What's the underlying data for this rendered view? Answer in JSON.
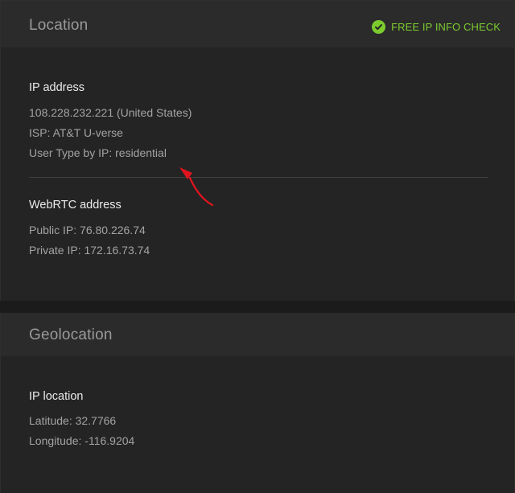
{
  "location": {
    "title": "Location",
    "free_check_label": "FREE IP INFO CHECK",
    "check_icon": "check-circle-icon",
    "ip_section": {
      "heading": "IP address",
      "ip_line": "108.228.232.221 (United States)",
      "isp_line": "ISP: AT&T U-verse",
      "user_type_line": "User Type by IP: residential"
    },
    "webrtc_section": {
      "heading": "WebRTC address",
      "public_ip_line": "Public IP: 76.80.226.74",
      "private_ip_line": "Private IP: 172.16.73.74"
    }
  },
  "geolocation": {
    "title": "Geolocation",
    "ip_location": {
      "heading": "IP location",
      "latitude_line": "Latitude: 32.7766",
      "longitude_line": "Longitude: -116.9204"
    }
  },
  "colors": {
    "accent_green": "#7ccc2e",
    "annotation_red": "#e0141e"
  }
}
